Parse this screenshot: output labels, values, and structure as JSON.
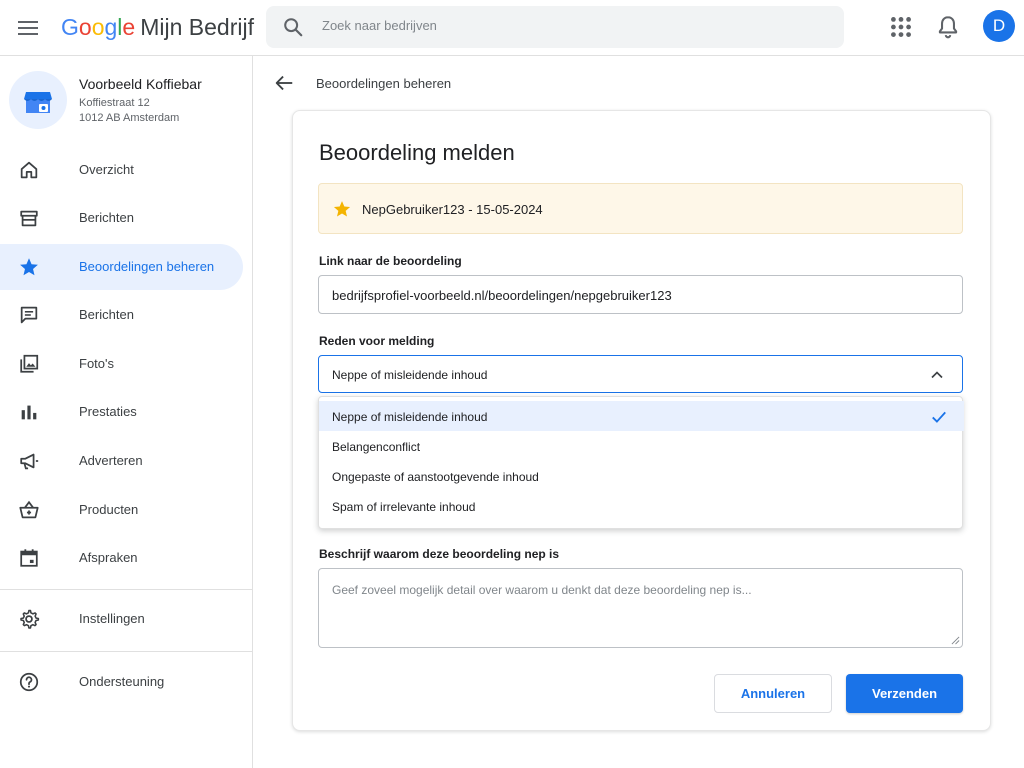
{
  "header": {
    "logo_g1": "G",
    "logo_g2": "o",
    "logo_g3": "o",
    "logo_g4": "g",
    "logo_g5": "l",
    "logo_g6": "e",
    "product": "Mijn Bedrijf",
    "search_placeholder": "Zoek naar bedrijven",
    "avatar_letter": "D"
  },
  "business": {
    "name": "Voorbeeld Koffiebar",
    "address_line1": "Koffiestraat 12",
    "address_line2": "1012 AB Amsterdam"
  },
  "sidebar": {
    "items": [
      {
        "label": "Overzicht",
        "icon": "home-icon"
      },
      {
        "label": "Berichten",
        "icon": "storefront-icon"
      },
      {
        "label": "Beoordelingen beheren",
        "icon": "star-icon",
        "active": true
      },
      {
        "label": "Berichten",
        "icon": "chat-icon"
      },
      {
        "label": "Foto's",
        "icon": "photos-icon"
      },
      {
        "label": "Prestaties",
        "icon": "bar-chart-icon"
      },
      {
        "label": "Adverteren",
        "icon": "megaphone-icon"
      },
      {
        "label": "Producten",
        "icon": "basket-icon"
      },
      {
        "label": "Afspraken",
        "icon": "calendar-icon"
      },
      {
        "label": "Instellingen",
        "icon": "gear-icon"
      },
      {
        "label": "Ondersteuning",
        "icon": "help-icon"
      }
    ]
  },
  "main": {
    "breadcrumb": "Beoordelingen beheren",
    "title": "Beoordeling melden",
    "review": "NepGebruiker123 - 15-05-2024",
    "link_label": "Link naar de beoordeling",
    "link_value": "bedrijfsprofiel-voorbeeld.nl/beoordelingen/nepgebruiker123",
    "reason_label": "Reden voor melding",
    "reason_value": "Neppe of misleidende inhoud",
    "reason_options": [
      "Neppe of misleidende inhoud",
      "Belangenconflict",
      "Ongepaste of aanstootgevende inhoud",
      "Spam of irrelevante inhoud"
    ],
    "describe_label": "Beschrijf waarom deze beoordeling nep is",
    "describe_placeholder": "Geef zoveel mogelijk detail over waarom u denkt dat deze beoordeling nep is...",
    "cancel_label": "Annuleren",
    "submit_label": "Verzenden"
  },
  "colors": {
    "accent": "#1a73e8",
    "active_bg": "#e8f0fe",
    "review_bg": "#fef7e8",
    "star": "#f4b400"
  }
}
